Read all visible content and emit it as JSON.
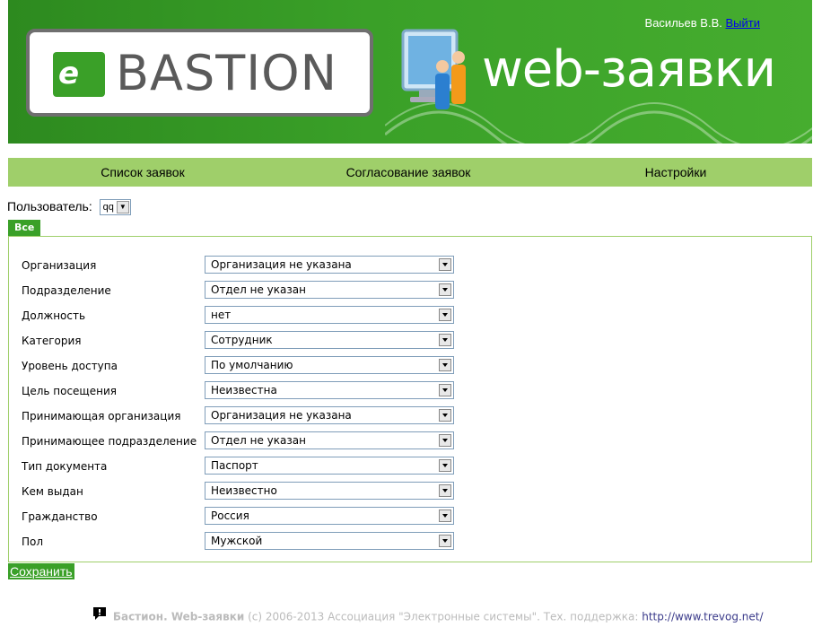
{
  "header": {
    "logo_letter": "e",
    "logo_text": "BASTION",
    "product_text": "web-заявки",
    "user_name": "Васильев В.В.",
    "logout_label": "Выйти"
  },
  "nav": {
    "items": [
      {
        "label": "Список заявок"
      },
      {
        "label": "Согласование заявок"
      },
      {
        "label": "Настройки"
      }
    ]
  },
  "user_filter": {
    "label": "Пользователь:",
    "value": "qq"
  },
  "tab": {
    "label": "Все"
  },
  "form": {
    "fields": [
      {
        "label": "Организация",
        "value": "Организация не указана"
      },
      {
        "label": "Подразделение",
        "value": "Отдел не указан"
      },
      {
        "label": "Должность",
        "value": "нет"
      },
      {
        "label": "Категория",
        "value": "Сотрудник"
      },
      {
        "label": "Уровень доступа",
        "value": "По умолчанию"
      },
      {
        "label": "Цель посещения",
        "value": "Неизвестна"
      },
      {
        "label": "Принимающая организация",
        "value": "Организация не указана"
      },
      {
        "label": "Принимающее подразделение",
        "value": "Отдел не указан"
      },
      {
        "label": "Тип документа",
        "value": "Паспорт"
      },
      {
        "label": "Кем выдан",
        "value": "Неизвестно"
      },
      {
        "label": "Гражданство",
        "value": "Россия"
      },
      {
        "label": "Пол",
        "value": "Мужской"
      }
    ]
  },
  "save_label": "Сохранить",
  "footer": {
    "product": "Бастион. Web-заявки",
    "copyright": "(c) 2006-2013 Ассоциация \"Электронные системы\". Тех. поддержка:",
    "support_url": "http://www.trevog.net/"
  },
  "colors": {
    "brand_green": "#3aa028",
    "nav_green": "#9fcf6a"
  }
}
